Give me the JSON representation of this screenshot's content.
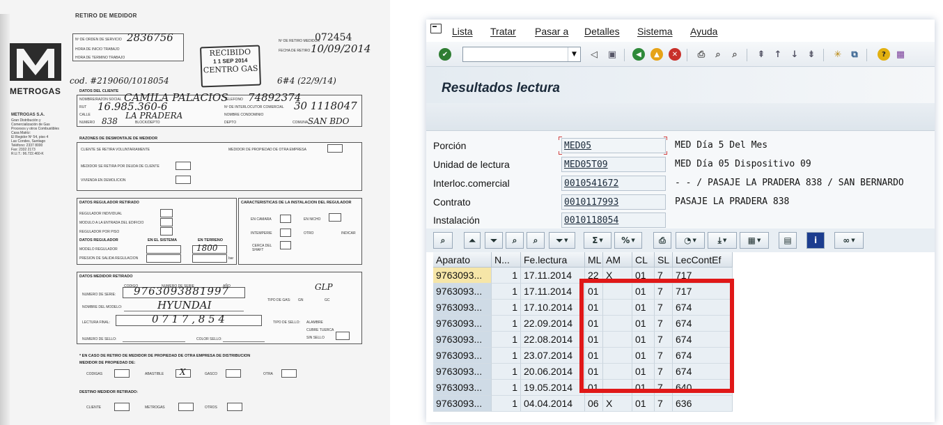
{
  "form": {
    "title": "RETIRO DE MEDIDOR",
    "logo_text": "METROGAS",
    "company_name": "METROGAS S.A.",
    "company_lines": [
      "Gran Distribución y",
      "Comercialización de Gas",
      "Procesos y otros Combustibles",
      "Casa Matriz:",
      "El Regidor Nº 54, piso 4",
      "Las Condes, Santiago",
      "Teléfono: 2337 8000",
      "Fax: 2332 2173",
      "R.U.T.: 96.722.460-K"
    ],
    "labels": {
      "orden": "Nº DE ORDEN DE SERVICIO",
      "hora_inicio": "HORA DE INICIO TRABAJO",
      "hora_termino": "HORA DE TERMINO TRABAJO",
      "numero_retiro": "Nº DE RETIRO MEDIDOR",
      "fecha_retiro": "FECHA DE RETIRO",
      "datos_cliente": "DATOS DEL CLIENTE",
      "nombre_razon": "NOMBRE/RAZON SOCIAL",
      "rut": "RUT",
      "calle": "CALLE",
      "numero": "NUMERO",
      "block": "BLOCK/DEPTO",
      "telefono": "TELEFONO",
      "interlocutor": "Nº DE INTERLOCUTOR COMERCIAL",
      "condominio": "NOMBRE CONDOMINIO",
      "depto": "DEPTO",
      "comuna": "COMUNA",
      "razones": "RAZONES DE DESMONTAJE DE MEDIDOR",
      "voluntario": "CLIENTE SE RETIRA VOLUNTARIAMENTE",
      "otra_empresa": "MEDIDOR DE PROPIEDAD DE OTRA EMPRESA",
      "deuda": "MEDIDOR SE RETIRA POR DEUDA DE CLIENTE",
      "demolicion": "VIVIENDA EN DEMOLICION",
      "regulador": "DATOS REGULADOR RETIRADO",
      "caracteristicas": "CARACTERISTICAS DE LA INSTALACION DEL REGULADOR",
      "reg_individual": "REGULADOR INDIVIDUAL",
      "modulo": "MODULO A LA ENTRADA DEL EDIFICIO",
      "reg_piso": "REGULADOR POR PISO",
      "datos_reg": "DATOS REGULADOR",
      "en_sistema": "EN EL SISTEMA",
      "en_terreno": "EN TERRENO",
      "modelo_reg": "MODELO REGULADOR",
      "presion": "PRESION DE SALIDA REGULACION",
      "en_camara": "EN CAMARA",
      "en_nicho": "EN NICHO",
      "intemperie": "INTEMPERIE",
      "otro": "OTRO",
      "indicar": "INDICAR",
      "cerca_shaft": "CERCA DEL SHAFT",
      "bar": "bar",
      "datos_medidor": "DATOS MEDIDOR RETIRADO",
      "codigo": "CODIGO",
      "numero_serie_h": "NUMERO DE SERIE",
      "anio": "AÑO",
      "numero_serie": "NUMERO DE SERIE:",
      "modelo": "NOMBRE DEL MODELO:",
      "lectura_final": "LECTURA FINAL:",
      "numero_sello": "NUMERO DE SELLO:",
      "color_sello": "COLOR SELLO:",
      "tipo_gas": "TIPO DE GAS:",
      "gn": "GN",
      "gc": "GC",
      "tipo_sello": "TIPO DE SELLO:",
      "alambre": "ALAMBRE",
      "cubre_tuerca": "CUBRE TUERCA",
      "sin_sello": "SIN SELLO",
      "otra_dist": "* EN CASO DE RETIRO DE MEDIDOR DE PROPIEDAD DE OTRA EMPRESA DE DISTRIBUCION",
      "medidor_prop": "MEDIDOR DE PROPIEDAD DE:",
      "codigas": "CODIGAS",
      "abastible": "ABASTIBLE",
      "gasco": "GASCO",
      "otra": "OTRA",
      "destino": "DESTINO MEDIDOR RETIRADO:",
      "cliente": "CLIENTE",
      "metrogas": "METROGAS",
      "otros": "OTROS"
    },
    "stamp": {
      "line1": "RECIBIDO",
      "date": "1 1 SEP 2014",
      "line3": "CENTRO GAS"
    },
    "hand": {
      "orden": "2836756",
      "retiro": "072454",
      "fecha": "10/09/2014",
      "cod": "cod. #219060/1018054",
      "nota": "6#4 (22/9/14)",
      "nombre": "CAMILA PALACIOS",
      "rut": "16.985.360-6",
      "calle": "LA PRADERA",
      "numero": "838",
      "telefono": "74892374",
      "interlocutor": "30 1118047",
      "comuna": "SAN BDO",
      "modelo_reg": "1800",
      "glp": "GLP",
      "serie": "9763093881997",
      "modelo": "HYUNDAI",
      "lectura": "0 7 1 7 , 8 5 4"
    }
  },
  "sap": {
    "menu": [
      "Lista",
      "Tratar",
      "Pasar a",
      "Detalles",
      "Sistema",
      "Ayuda"
    ],
    "title": "Resultados lectura",
    "fields": [
      {
        "label": "Porción",
        "value": "MED05",
        "desc": "MED Día  5 Del Mes"
      },
      {
        "label": "Unidad de lectura",
        "value": "MED05T09",
        "desc": "MED Día 05 Dispositivo 09"
      },
      {
        "label": "Interloc.comercial",
        "value": "0010541672",
        "desc": "- - / PASAJE LA PRADERA 838 / SAN BERNARDO"
      },
      {
        "label": "Contrato",
        "value": "0010117993",
        "desc": "PASAJE LA PRADERA 838"
      },
      {
        "label": "Instalación",
        "value": "0010118054",
        "desc": ""
      }
    ],
    "grid": {
      "columns": [
        "Aparato",
        "N...",
        "Fe.lectura",
        "ML",
        "AM",
        "CL",
        "SL",
        "LecContEf"
      ],
      "rows": [
        [
          "9763093...",
          "1",
          "17.11.2014",
          "22",
          "X",
          "01",
          "7",
          "717"
        ],
        [
          "9763093...",
          "1",
          "17.11.2014",
          "01",
          "",
          "01",
          "7",
          "717"
        ],
        [
          "9763093...",
          "1",
          "17.10.2014",
          "01",
          "",
          "01",
          "7",
          "674"
        ],
        [
          "9763093...",
          "1",
          "22.09.2014",
          "01",
          "",
          "01",
          "7",
          "674"
        ],
        [
          "9763093...",
          "1",
          "22.08.2014",
          "01",
          "",
          "01",
          "7",
          "674"
        ],
        [
          "9763093...",
          "1",
          "23.07.2014",
          "01",
          "",
          "01",
          "7",
          "674"
        ],
        [
          "9763093...",
          "1",
          "20.06.2014",
          "01",
          "",
          "01",
          "7",
          "674"
        ],
        [
          "9763093...",
          "1",
          "19.05.2014",
          "01",
          "",
          "01",
          "7",
          "640"
        ],
        [
          "9763093...",
          "1",
          "04.04.2014",
          "06",
          "X",
          "01",
          "7",
          "636"
        ]
      ]
    },
    "colors": {
      "highlight": "#e01818",
      "selected_cell": "#f6e6a8",
      "title_text": "#1b2a3a"
    }
  }
}
